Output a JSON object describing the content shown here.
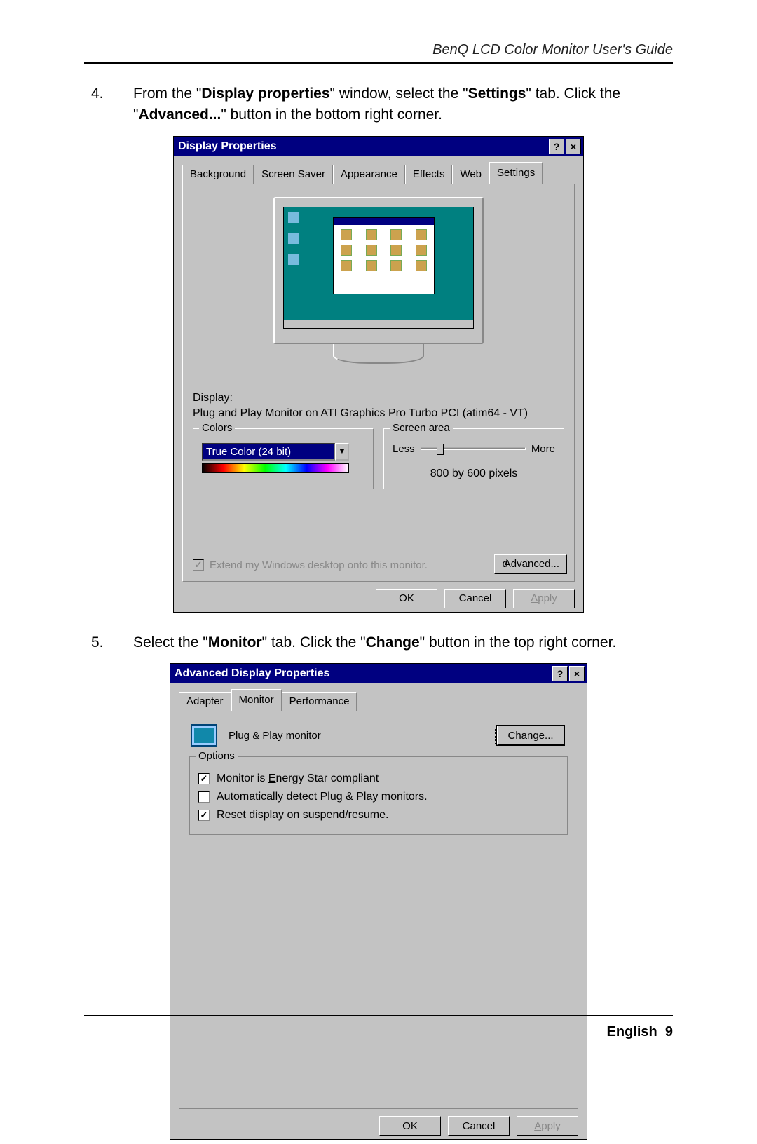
{
  "running_head": "BenQ LCD Color Monitor User's Guide",
  "steps": {
    "s4": {
      "num": "4.",
      "pre": "From the \"",
      "b1": "Display properties",
      "mid1": "\" window, select the \"",
      "b2": "Settings",
      "mid2": "\" tab. Click the \"",
      "b3": "Advanced...",
      "post": "\" button in the bottom right corner."
    },
    "s5": {
      "num": "5.",
      "pre": "Select the \"",
      "b1": "Monitor",
      "mid1": "\" tab. Click the \"",
      "b2": "Change",
      "post": "\" button in the top right corner."
    }
  },
  "dlg1": {
    "title": "Display Properties",
    "help": "?",
    "close": "×",
    "tabs": {
      "t1": "Background",
      "t2": "Screen Saver",
      "t3": "Appearance",
      "t4": "Effects",
      "t5": "Web",
      "t6": "Settings"
    },
    "display_label": "Display:",
    "display_desc": "Plug and Play Monitor on ATI Graphics Pro Turbo PCI (atim64 - VT)",
    "colors_legend": "Colors",
    "colors_value": "True Color (24 bit)",
    "area_legend": "Screen area",
    "less": "Less",
    "more": "More",
    "resolution": "800 by 600 pixels",
    "extend": "Extend my Windows desktop onto this monitor.",
    "advanced": "Advanced...",
    "ok": "OK",
    "cancel": "Cancel",
    "apply": "Apply"
  },
  "dlg2": {
    "title": "Advanced Display Properties",
    "help": "?",
    "close": "×",
    "tabs": {
      "t1": "Adapter",
      "t2": "Monitor",
      "t3": "Performance"
    },
    "monitor_name": "Plug & Play monitor",
    "change": "Change...",
    "change_ul": "C",
    "options_legend": "Options",
    "opt1_pre": "Monitor is ",
    "opt1_ul": "E",
    "opt1_post": "nergy Star compliant",
    "opt2_pre": "Automatically detect ",
    "opt2_ul": "P",
    "opt2_post": "lug & Play monitors.",
    "opt3_ul": "R",
    "opt3_post": "eset display on suspend/resume.",
    "ok": "OK",
    "cancel": "Cancel",
    "apply": "Apply"
  },
  "footer": {
    "lang": "English",
    "page": "9"
  }
}
